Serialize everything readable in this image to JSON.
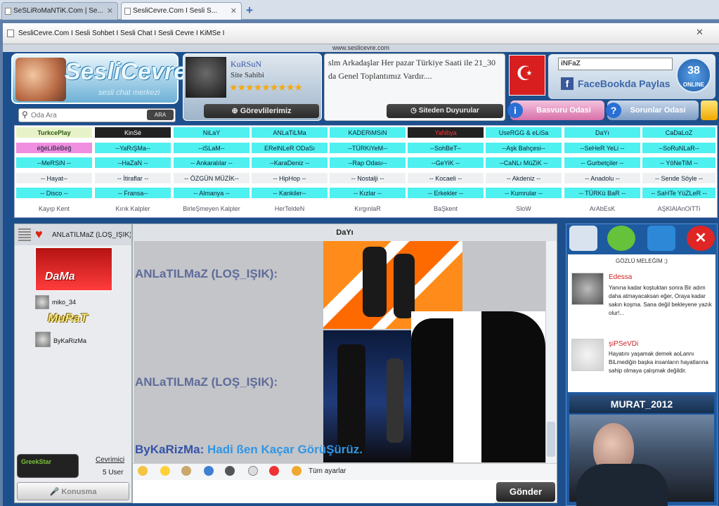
{
  "browser": {
    "tabs": [
      {
        "label": "SeSLiRoMaNTiK.Com | Se..."
      },
      {
        "label": "SesliCevre.Com I Sesli S..."
      }
    ],
    "window_title": "SesliCevre.Com I Sesli Sohbet I Sesli Chat I Sesli Cevre I KiMSe I",
    "url_strip": "www.seslicevre.com"
  },
  "header": {
    "logo_text": "SesliCevre",
    "logo_sub": "sesli chat merkezi",
    "search_placeholder": "Oda Ara",
    "search_button": "ARA",
    "owner_name": "KuRSuN",
    "owner_role": "Site Sahibi",
    "stars": "★★★★★★★★★",
    "duties_button": "Görevlilerimiz",
    "announcement": "slm Arkadaşlar Her pazar Türkiye Saati ile 21_30 da Genel Toplantımız Vardır....",
    "announcement_button": "Siteden Duyurular",
    "fb_input": "iNFaZ",
    "fb_share": "FaceBookda Paylas",
    "online_count": "38",
    "online_label": "ONLINE",
    "apply_button": "Basvuru Odasi",
    "problems_button": "Sorunlar Odasi"
  },
  "rooms": [
    [
      "TurkcePlay",
      "KinSé",
      "NiLaY",
      "ANLaTiLMa",
      "KADERiMSiN",
      "YaNbya",
      "UseRGG & eLiSa",
      "DaYı",
      "CaDaLoZ"
    ],
    [
      "éğéLiBéBéğ",
      "--YaRıŞMa--",
      "--iSLaM--",
      "ERelNLeR ODaSı",
      "--TÜRKiYeM--",
      "--SohBeT--",
      "--Aşk Bahçesi--",
      "--SeHeR YeLi --",
      "--SoRuNLaR--"
    ],
    [
      "--MeRSiN --",
      "--HaZaN --",
      "-- Ankaralılar --",
      "--KaraDeniz --",
      "--Rap Odası--",
      "--GeYiK --",
      "--CaNLı MüZiK --",
      "-- Gurbetçiler --",
      "-- YöNeTiM --"
    ],
    [
      "-- Hayat--",
      "-- İtiraflar --",
      "-- ÖZGÜN MÜZİK--",
      "-- HipHop --",
      "-- Nostalji --",
      "-- Kocaeli --",
      "-- Akdeniz --",
      "-- Anadolu --",
      "-- Sende Söyle --"
    ],
    [
      "-- Disco --",
      "-- Fransa--",
      "-- Almanya --",
      "-- Kankiler--",
      "-- Kızlar --",
      "-- Erkekler --",
      "-- Kumrular --",
      "-- TÜRKü BaR --",
      "-- SaHTe YüZLeR --"
    ],
    [
      "Kayıp Kent",
      "Kırık Kalpler",
      "BirleŞmeyen Kalpler",
      "HerTeldeN",
      "KırgınlaR",
      "BaŞkent",
      "SloW",
      "ArAbEsK",
      "AŞKlAlAnOiTTi"
    ]
  ],
  "left_panel": {
    "room_user": "ANLaTILMaZ (LOŞ_IŞIK)",
    "banner_text": "DaMa",
    "users": [
      {
        "name": "miko_34"
      },
      {
        "name": "MuRaT"
      },
      {
        "name": "ByKaRizMa"
      }
    ],
    "badge": "GreekStar",
    "online_link": "Cevrimici",
    "user_count": "5 User",
    "talk_button": "Konusma"
  },
  "chat": {
    "room_title": "DaYı",
    "messages": [
      {
        "sender": "ANLaTILMaZ (LOŞ_IŞIK):"
      },
      {
        "sender": "ANLaTILMaZ (LOŞ_IŞIK):"
      }
    ],
    "last_sender": "ByKaRizMa:",
    "last_text": "Hadi ßen Kaçar GörüŞürüz.",
    "settings_label": "Tüm ayarlar",
    "send_button": "Gönder"
  },
  "right_panel": {
    "feed_header": "GÖZLÜ MELEĞİM ;)",
    "feed": [
      {
        "name": "Edessa",
        "text": "Yanına kadar koştuktan sonra Bir adım daha atmayacaksan eğer, Oraya kadar sakın koşma. Sana değil bekleyene yazık olur!..."
      },
      {
        "name": "şiPSeVDi",
        "text": "Hayatını yaşamak demek aoLannı BiLmediğin başka insanların hayatlarına sahip olmaya çalışmak değildir."
      }
    ],
    "cam_user": "MURAT_2012"
  },
  "colors": {
    "room_cyan": "#4ff0f0",
    "room_pink": "#f08ee0",
    "header_blue": "#1c4f8c"
  }
}
